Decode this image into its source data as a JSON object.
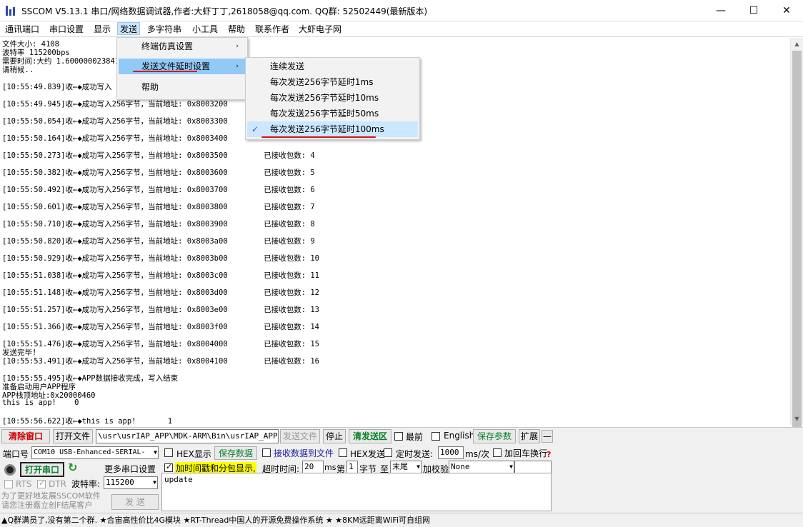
{
  "window": {
    "title": "SSCOM V5.13.1 串口/网络数据调试器,作者:大虾丁丁,2618058@qq.com. QQ群: 52502449(最新版本)",
    "min_icon": "—",
    "max_icon": "☐",
    "close_icon": "✕"
  },
  "menubar": [
    "通讯端口",
    "串口设置",
    "显示",
    "发送",
    "多字符串",
    "小工具",
    "帮助",
    "联系作者",
    "大虾电子网"
  ],
  "dropdown": {
    "items": [
      {
        "label": "终端仿真设置",
        "arrow": "›"
      },
      {
        "label": "发送文件延时设置",
        "arrow": "›"
      },
      {
        "label": "帮助",
        "arrow": ""
      }
    ]
  },
  "submenu": {
    "items": [
      {
        "label": "连续发送",
        "checked": false
      },
      {
        "label": "每次发送256字节延时1ms",
        "checked": false
      },
      {
        "label": "每次发送256字节延时10ms",
        "checked": false
      },
      {
        "label": "每次发送256字节延时50ms",
        "checked": false
      },
      {
        "label": "每次发送256字节延时100ms",
        "checked": true
      }
    ],
    "check_mark": "✓"
  },
  "log_lines": [
    "文件大小: 4108",
    "波特率 115200bps",
    "需要时间:大约 1.6000000238418",
    "请稍候..",
    "[10:55:49.839]收←◆成功写入",
    "[10:55:49.945]收←◆成功写入256字节，当前地址: 0x8003200",
    "[10:55:50.054]收←◆成功写入256字节，当前地址: 0x8003300",
    "[10:55:50.164]收←◆成功写入256字节，当前地址: 0x8003400",
    "[10:55:50.273]收←◆成功写入256字节，当前地址: 0x8003500        已接收包数: 4",
    "[10:55:50.382]收←◆成功写入256字节，当前地址: 0x8003600        已接收包数: 5",
    "[10:55:50.492]收←◆成功写入256字节，当前地址: 0x8003700        已接收包数: 6",
    "[10:55:50.601]收←◆成功写入256字节，当前地址: 0x8003800        已接收包数: 7",
    "[10:55:50.710]收←◆成功写入256字节，当前地址: 0x8003900        已接收包数: 8",
    "[10:55:50.820]收←◆成功写入256字节，当前地址: 0x8003a00        已接收包数: 9",
    "[10:55:50.929]收←◆成功写入256字节，当前地址: 0x8003b00        已接收包数: 10",
    "[10:55:51.038]收←◆成功写入256字节，当前地址: 0x8003c00        已接收包数: 11",
    "[10:55:51.148]收←◆成功写入256字节，当前地址: 0x8003d00        已接收包数: 12",
    "[10:55:51.257]收←◆成功写入256字节，当前地址: 0x8003e00        已接收包数: 13",
    "[10:55:51.366]收←◆成功写入256字节，当前地址: 0x8003f00        已接收包数: 14",
    "[10:55:51.476]收←◆成功写入256字节，当前地址: 0x8004000        已接收包数: 15",
    "发送完毕!",
    "[10:55:53.491]收←◆成功写入256字节，当前地址: 0x8004100        已接收包数: 16",
    "[10:55:55.495]收←◆APP数据接收完成，写入结束",
    "准备启动用户APP程序",
    "APP栈顶地址:0x20000460",
    "this is app!    0",
    "[10:55:56.622]收←◆this is app!       1"
  ],
  "toolbar": {
    "clear": "清除窗口",
    "open_file": "打开文件",
    "file_path": "\\usr\\usrIAP_APP\\MDK-ARM\\Bin\\usrIAP_APP.bin",
    "send_file": "发送文件",
    "stop": "停止",
    "clear_send": "清发送区",
    "topmost": "最前",
    "english": "English",
    "save_params": "保存参数",
    "expand": "扩展",
    "collapse": "—"
  },
  "panel": {
    "port_label": "端口号",
    "port_value": "COM10 USB-Enhanced-SERIAL-",
    "hex_display": "HEX显示",
    "save_data": "保存数据",
    "recv_to_file": "接收数据到文件",
    "hex_send": "HEX发送",
    "timed_send": "定时发送:",
    "interval": "1000",
    "interval_unit": "ms/次",
    "add_crlf": "加回车换行",
    "help_mark": "?",
    "open_port": "打开串口",
    "more_settings": "更多串口设置",
    "add_timestamp": "加时间戳和分包显示,",
    "timeout_label": "超时时间:",
    "timeout_value": "20",
    "timeout_unit": "ms",
    "nth_label": "第",
    "nth_value": "1",
    "byte_label": "字节",
    "to_label": "至",
    "end_value": "末尾",
    "checksum_label": "加校验",
    "checksum_value": "None",
    "rts": "RTS",
    "dtr": "DTR",
    "baud_label": "波特率:",
    "baud_value": "115200",
    "promo": "为了更好地发展SSCOM软件\n请您注册嘉立创F结尾客户",
    "send": "发 送",
    "send_text": "update"
  },
  "statusbar": "▲Q群满员了,没有第二个群.  ★合宙高性价比4G模块  ★RT-Thread中国人的开源免费操作系统  ★  ★8KM远距离WiFi可自组网"
}
